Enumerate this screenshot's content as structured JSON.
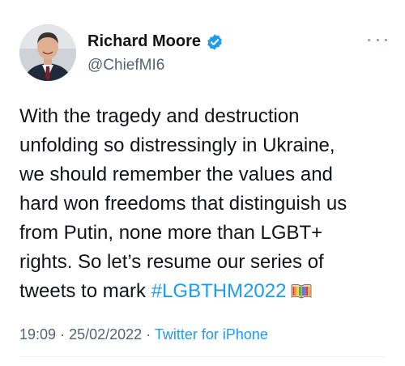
{
  "author": {
    "name": "Richard Moore",
    "handle": "@ChiefMI6",
    "verified": true,
    "avatar_icon": "profile-photo"
  },
  "tweet": {
    "lines": [
      "With the tragedy and destruction",
      "unfolding so distressingly in Ukraine,",
      "we should remember the values and",
      "hard won freedoms that distinguish us",
      "from Putin, none more than LGBT+",
      "rights. So let’s resume our series of",
      "tweets to mark "
    ],
    "hashtag": "#LGBTHM2022",
    "emoji_icon": "rainbow-book-icon"
  },
  "meta": {
    "time": "19:09",
    "separator": "·",
    "date": "25/02/2022",
    "source": "Twitter for iPhone"
  },
  "colors": {
    "text": "#0f1419",
    "secondary": "#536471",
    "link": "#1d9bf0",
    "verified_badge": "#1d9bf0"
  },
  "icons": {
    "more": "more-options-icon",
    "verified": "verified-badge-icon"
  }
}
